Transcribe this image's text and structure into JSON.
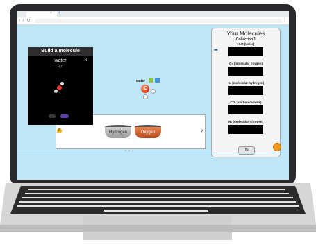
{
  "browser": {
    "tab_title": "",
    "tab_close": "×",
    "new_tab": "+",
    "nav_icons": "‹ › ↻",
    "menu_dots": "⋮"
  },
  "molecules_panel": {
    "title": "Your Molecules",
    "collection": "Collection 1",
    "slots": [
      {
        "label": "H₂O (water)",
        "selected": true
      },
      {
        "label": "O₂ (molecular oxygen)",
        "selected": false
      },
      {
        "label": "H₂ (molecular hydrogen)",
        "selected": false
      },
      {
        "label": "CO₂ (carbon dioxide)",
        "selected": false
      },
      {
        "label": "N₂ (molecular nitrogen)",
        "selected": false
      }
    ],
    "reset_glyph": "↻",
    "arrow_glyph": "➡"
  },
  "workspace": {
    "molecule_label": "water",
    "atom_letter": "O",
    "icon1": "3d-view-icon",
    "icon2": "grid-icon"
  },
  "kit": {
    "prev": "‹",
    "next": "›",
    "buckets": [
      {
        "label": "Hydrogen",
        "color": "#b0b0b0"
      },
      {
        "label": "Oxygen",
        "color": "#d4652f"
      }
    ],
    "pager": "• • •"
  },
  "popup": {
    "header": "Build a molecule",
    "close": "×",
    "molecule_name": "water",
    "formula": "H₂O",
    "badge": "8"
  },
  "colors": {
    "screen_bg": "#bfe6f7",
    "accent_orange": "#f29a1f",
    "arrow_blue": "#1f5fa8"
  }
}
